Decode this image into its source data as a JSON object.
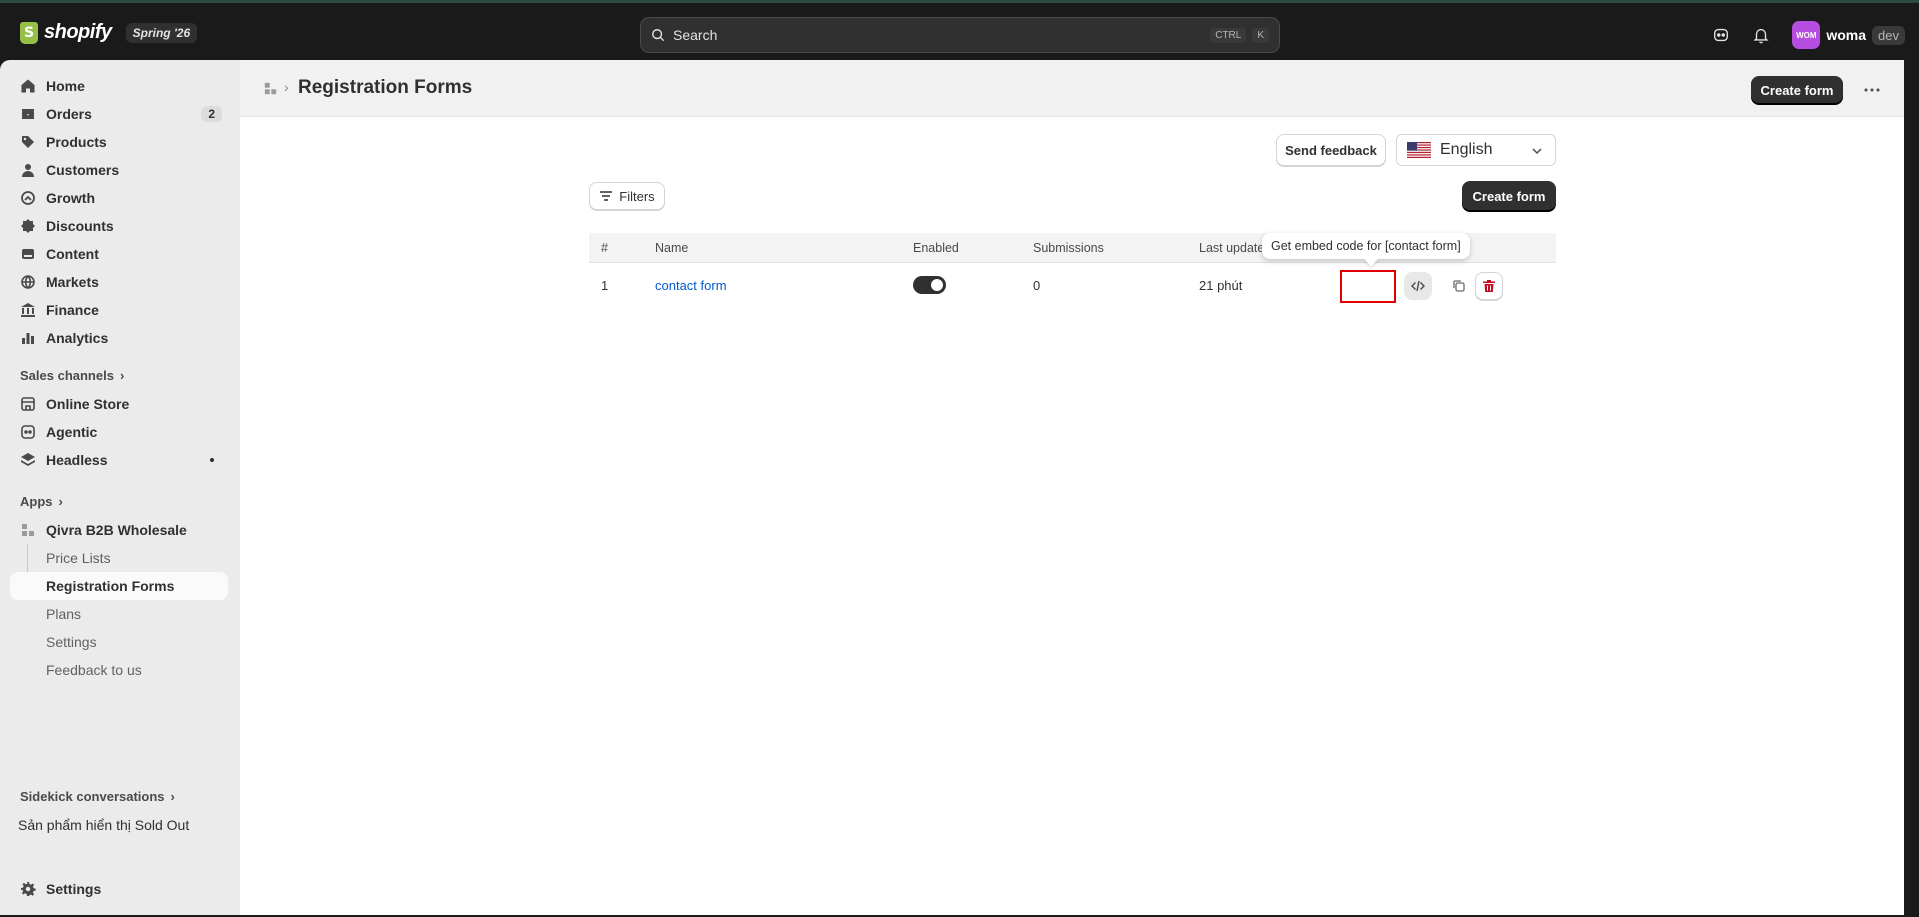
{
  "topbar": {
    "logo_text": "shopify",
    "edition_badge": "Spring '26",
    "search_placeholder": "Search",
    "search_kbd_1": "CTRL",
    "search_kbd_2": "K",
    "avatar_initials": "WOM",
    "user_name": "woma",
    "user_badge": "dev"
  },
  "sidebar": {
    "items": [
      {
        "label": "Home",
        "icon": "home-icon"
      },
      {
        "label": "Orders",
        "icon": "orders-icon",
        "badge": "2"
      },
      {
        "label": "Products",
        "icon": "tag-icon"
      },
      {
        "label": "Customers",
        "icon": "person-icon"
      },
      {
        "label": "Growth",
        "icon": "growth-icon"
      },
      {
        "label": "Discounts",
        "icon": "discount-icon"
      },
      {
        "label": "Content",
        "icon": "content-icon"
      },
      {
        "label": "Markets",
        "icon": "globe-icon"
      },
      {
        "label": "Finance",
        "icon": "bank-icon"
      },
      {
        "label": "Analytics",
        "icon": "bar-chart-icon"
      }
    ],
    "sales_channels_label": "Sales channels",
    "channels": [
      {
        "label": "Online Store",
        "icon": "store-icon"
      },
      {
        "label": "Agentic",
        "icon": "agent-icon"
      },
      {
        "label": "Headless",
        "icon": "headless-icon"
      }
    ],
    "apps_label": "Apps",
    "app_name": "Qivra B2B Wholesale",
    "app_pages": [
      "Price Lists",
      "Registration Forms",
      "Plans",
      "Settings",
      "Feedback to us"
    ],
    "sidekick_label": "Sidekick conversations",
    "sidekick_item": "Sản phẩm hiển thị Sold Out",
    "settings_label": "Settings"
  },
  "page": {
    "title": "Registration Forms",
    "header_create_label": "Create form",
    "send_feedback_label": "Send feedback",
    "language_selected": "English",
    "filters_label": "Filters",
    "create_form_label": "Create form"
  },
  "table": {
    "headers": [
      "#",
      "Name",
      "Enabled",
      "Submissions",
      "Last updated"
    ],
    "rows": [
      {
        "index": "1",
        "name": "contact form",
        "enabled": true,
        "submissions": "0",
        "last_updated": "21 phút"
      }
    ]
  },
  "tooltip": {
    "text": "Get embed code for [contact form]"
  },
  "colors": {
    "accent_dark": "#303030",
    "link": "#005bd3",
    "delete": "#c70a24",
    "highlight": "#e00000",
    "avatar": "#b74ce0"
  }
}
